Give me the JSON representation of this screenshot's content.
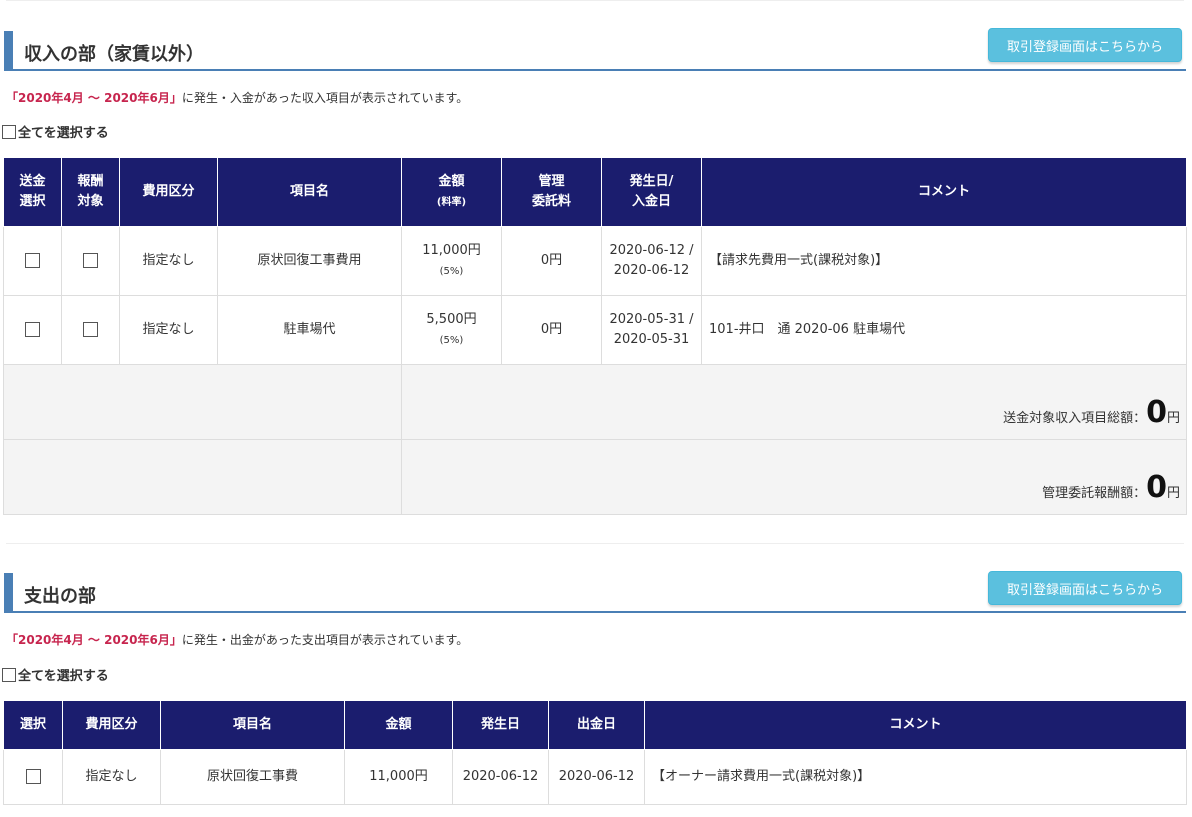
{
  "income": {
    "title": "収入の部（家賃以外）",
    "register_button": "取引登録画面はこちらから",
    "period_highlight": "「2020年4月 〜 2020年6月」",
    "period_text": "に発生・入金があった収入項目が表示されています。",
    "select_all": "全てを選択する",
    "headers": {
      "send_1": "送金",
      "send_2": "選択",
      "reward_1": "報酬",
      "reward_2": "対象",
      "category": "費用区分",
      "item": "項目名",
      "amount_1": "金額",
      "amount_2": "(料率)",
      "fee_1": "管理",
      "fee_2": "委託料",
      "date_1": "発生日/",
      "date_2": "入金日",
      "comment": "コメント"
    },
    "rows": [
      {
        "category": "指定なし",
        "item": "原状回復工事費用",
        "amount": "11,000円",
        "rate": "(5%)",
        "fee": "0円",
        "date_1": "2020-06-12 /",
        "date_2": "2020-06-12",
        "comment": "【請求先費用一式(課税対象)】"
      },
      {
        "category": "指定なし",
        "item": "駐車場代",
        "amount": "5,500円",
        "rate": "(5%)",
        "fee": "0円",
        "date_1": "2020-05-31 /",
        "date_2": "2020-05-31",
        "comment": "101-井口　通 2020-06 駐車場代"
      }
    ],
    "total_label": "送金対象収入項目総額：",
    "total_value": "0",
    "fee_total_label": "管理委託報酬額：",
    "fee_total_value": "0",
    "yen": "円"
  },
  "expense": {
    "title": "支出の部",
    "register_button": "取引登録画面はこちらから",
    "period_highlight": "「2020年4月 〜 2020年6月」",
    "period_text": "に発生・出金があった支出項目が表示されています。",
    "select_all": "全てを選択する",
    "headers": {
      "select": "選択",
      "category": "費用区分",
      "item": "項目名",
      "amount": "金額",
      "occur": "発生日",
      "pay": "出金日",
      "comment": "コメント"
    },
    "rows": [
      {
        "category": "指定なし",
        "item": "原状回復工事費",
        "amount": "11,000円",
        "occur": "2020-06-12",
        "pay": "2020-06-12",
        "comment": "【オーナー請求費用一式(課税対象)】"
      }
    ]
  },
  "colors": {
    "header_bg": "#1b1d6e",
    "accent_blue": "#4a7fb5",
    "button_bg": "#5bc0de",
    "period_red": "#c7254e"
  }
}
